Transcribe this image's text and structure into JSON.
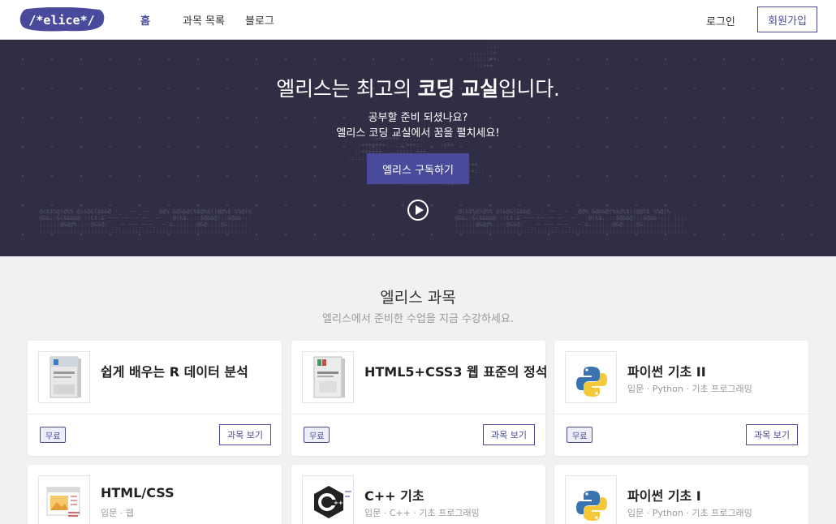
{
  "nav": {
    "logo_text": "/*elice*/",
    "links": [
      "홈",
      "과목 목록",
      "블로그"
    ],
    "login": "로그인",
    "signup": "회원가입"
  },
  "hero": {
    "title_pre": "엘리스는 최고의 ",
    "title_bold": "코딩 교실",
    "title_post": "입니다.",
    "sub1": "공부할 준비 되셨나요?",
    "sub2": "엘리스 코딩 교실에서 꿈을 펼치세요!",
    "cta": "엘리스 구독하기",
    "play_icon": "play-circle-icon"
  },
  "section": {
    "title": "엘리스 과목",
    "subtitle": "엘리스에서 준비한 수업을 지금 수강하세요."
  },
  "courses": [
    {
      "title": "쉽게 배우는 R 데이터 분석",
      "meta": "",
      "badge": "무료",
      "button": "과목 보기",
      "thumb": "book-cover-r"
    },
    {
      "title": "HTML5+CSS3 웹 표준의 정석",
      "meta": "",
      "badge": "무료",
      "button": "과목 보기",
      "thumb": "book-cover-html"
    },
    {
      "title": "파이썬 기초 II",
      "meta": "입문 · Python · 기초 프로그래밍",
      "badge": "무료",
      "button": "과목 보기",
      "thumb": "python-logo"
    },
    {
      "title": "HTML/CSS",
      "meta": "입문 · 웹",
      "thumb": "web-page-icon"
    },
    {
      "title": "C++ 기초",
      "meta": "입문 · C++ · 기초 프로그래밍",
      "thumb": "cpp-logo"
    },
    {
      "title": "파이썬 기초 I",
      "meta": "입문 · Python · 기초 프로그래밍",
      "thumb": "python-logo"
    }
  ],
  "colors": {
    "brand": "#4a4a9c",
    "hero_bg": "#2f2e44",
    "page_bg": "#f1f1f3"
  }
}
